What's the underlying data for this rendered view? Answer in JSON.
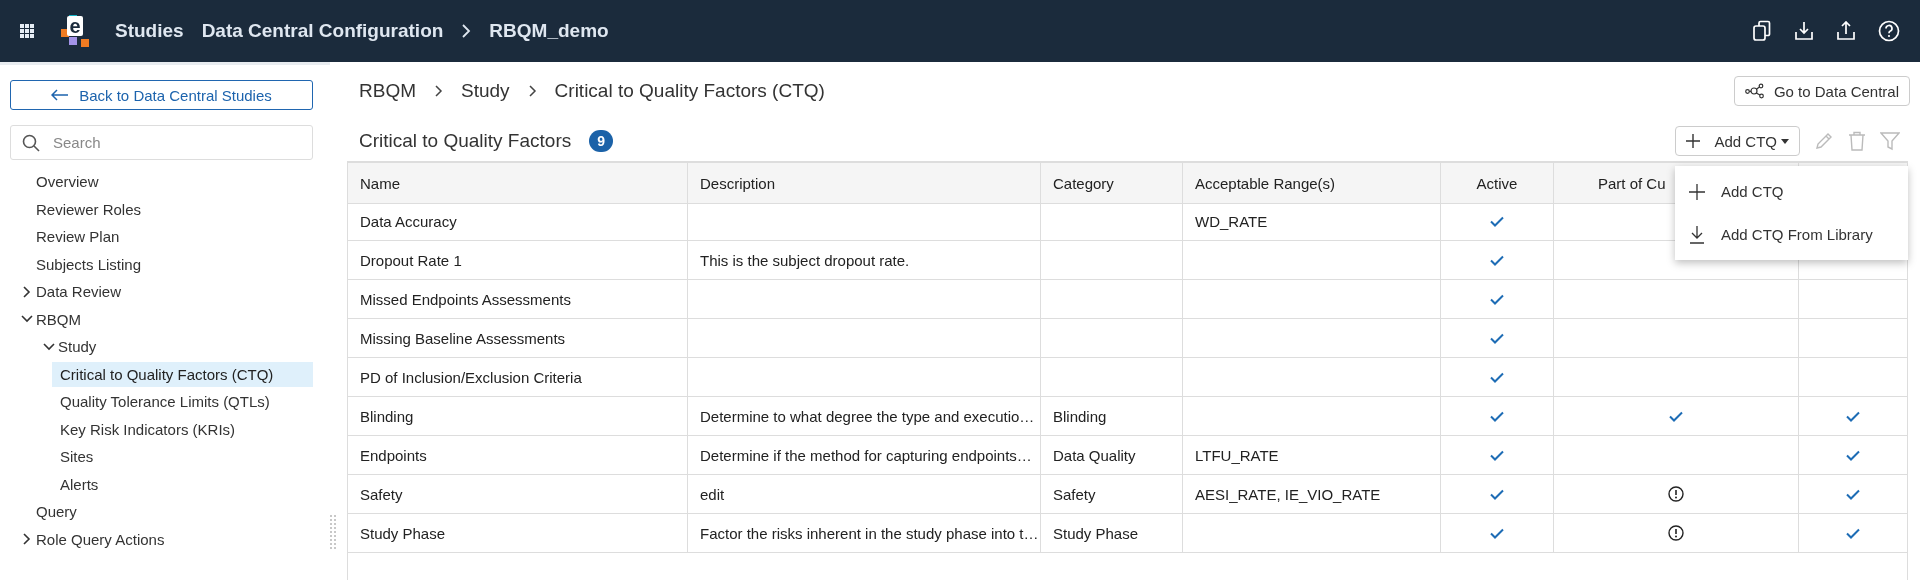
{
  "header": {
    "logo_text": "e",
    "crumbs": [
      "Studies",
      "Data Central Configuration",
      "RBQM_demo"
    ]
  },
  "sidebar": {
    "back_button": "Back to Data Central Studies",
    "search": {
      "placeholder": "Search"
    },
    "items": [
      {
        "label": "Overview",
        "selected": false
      },
      {
        "label": "Reviewer Roles",
        "selected": false
      },
      {
        "label": "Review Plan",
        "selected": false
      },
      {
        "label": "Subjects Listing",
        "selected": false
      },
      {
        "label": "Data Review",
        "selected": false,
        "expanded": false
      },
      {
        "label": "RBQM",
        "selected": false,
        "expanded": true,
        "children": [
          {
            "label": "Study",
            "selected": false,
            "expanded": true,
            "children": [
              {
                "label": "Critical to Quality Factors (CTQ)",
                "selected": true
              },
              {
                "label": "Quality Tolerance Limits (QTLs)",
                "selected": false
              },
              {
                "label": "Key Risk Indicators (KRIs)",
                "selected": false
              },
              {
                "label": "Sites",
                "selected": false
              },
              {
                "label": "Alerts",
                "selected": false
              }
            ]
          }
        ]
      },
      {
        "label": "Query",
        "selected": false
      },
      {
        "label": "Role Query Actions",
        "selected": false,
        "expanded": false
      }
    ]
  },
  "breadcrumb": [
    "RBQM",
    "Study",
    "Critical to Quality Factors (CTQ)"
  ],
  "go_button": "Go to Data Central",
  "title": "Critical to Quality Factors",
  "count": "9",
  "toolbar": {
    "add_button": "Add CTQ",
    "menu": [
      "Add CTQ",
      "Add CTQ From Library"
    ]
  },
  "table": {
    "columns": [
      "Name",
      "Description",
      "Category",
      "Acceptable Range(s)",
      "Active",
      "Part of Cu"
    ],
    "rows": [
      {
        "name": "Data Accuracy",
        "range": "WD_RATE",
        "active": true
      },
      {
        "name": "Dropout Rate 1",
        "description": "This is the subject dropout rate.",
        "active": true,
        "column_6_check": false,
        "column_6_alert": false,
        "column_7": false
      },
      {
        "name": "Missed Endpoints Assessments",
        "active": true,
        "column_6_check": false,
        "column_6_alert": false,
        "column_7": false
      },
      {
        "name": "Missing Baseline Assessments",
        "active": true,
        "column_6_check": false,
        "column_6_alert": false,
        "column_7": false
      },
      {
        "name": "PD of Inclusion/Exclusion Criteria",
        "active": true,
        "column_6_check": false,
        "column_6_alert": false,
        "column_7": false
      },
      {
        "name": "Blinding",
        "description": "Determine to what degree the type and executio…",
        "category": "Blinding",
        "active": true,
        "column_6_check": true,
        "column_6_alert": false,
        "column_7": true
      },
      {
        "name": "Endpoints",
        "description": "Determine if the method for capturing endpoints…",
        "category": "Data Quality",
        "range": "LTFU_RATE",
        "active": true,
        "column_6_check": false,
        "column_6_alert": false,
        "column_7": true
      },
      {
        "name": "Safety",
        "description": "edit",
        "category": "Safety",
        "range": "AESI_RATE, IE_VIO_RATE",
        "active": true,
        "column_6_check": false,
        "column_6_alert": true,
        "column_7": true
      },
      {
        "name": "Study Phase",
        "description": "Factor the risks inherent in the study phase into t…",
        "category": "Study Phase",
        "active": true,
        "column_6_check": false,
        "column_6_alert": true,
        "column_7": true
      }
    ]
  }
}
